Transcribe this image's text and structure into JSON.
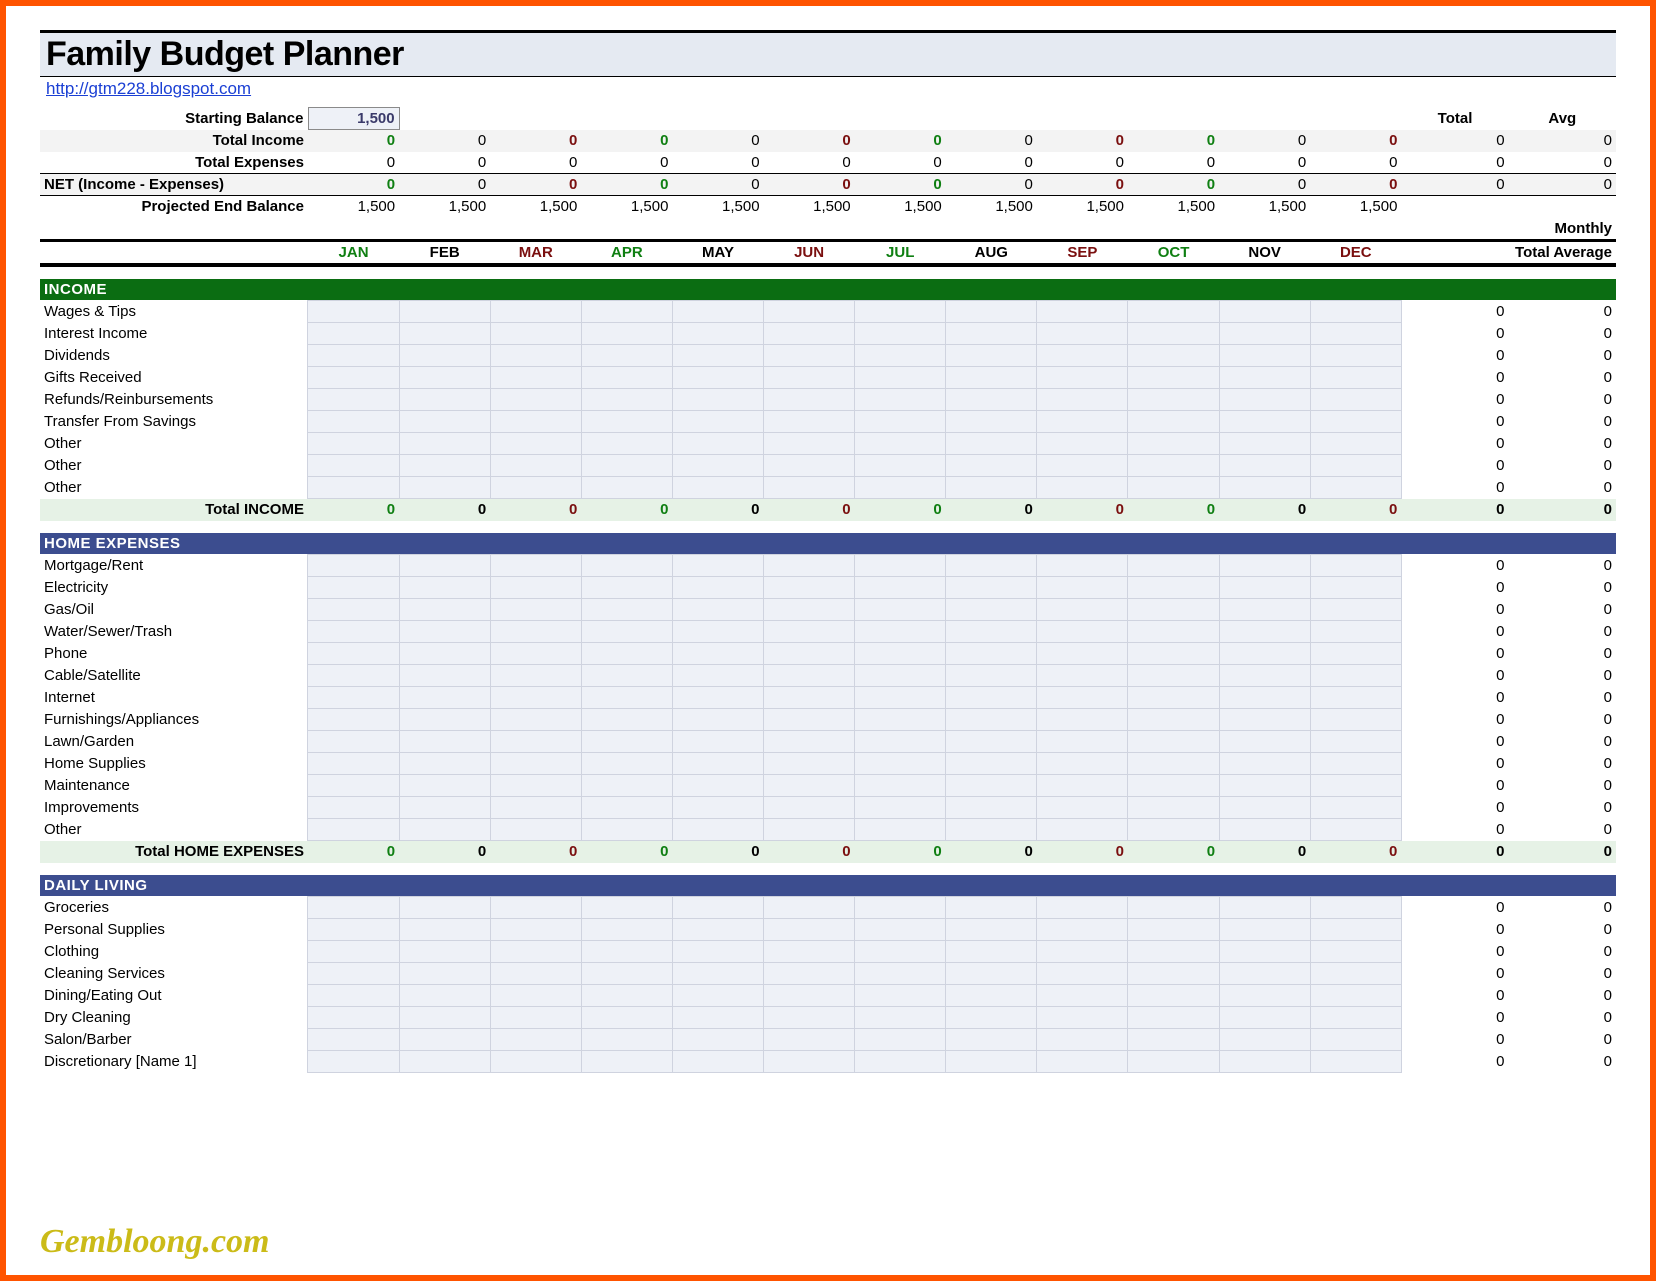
{
  "title": "Family Budget Planner",
  "sourceUrl": "http://gtm228.blogspot.com",
  "watermark": "Gembloong.com",
  "summary": {
    "startingBalanceLabel": "Starting Balance",
    "startingBalance": "1,500",
    "totalHeader": "Total",
    "avgHeader": "Avg",
    "monthlyLabel": "Monthly",
    "totalAverageLabel": "Total Average",
    "totalIncome": {
      "label": "Total Income",
      "months": [
        "0",
        "0",
        "0",
        "0",
        "0",
        "0",
        "0",
        "0",
        "0",
        "0",
        "0",
        "0"
      ],
      "total": "0",
      "avg": "0"
    },
    "totalExpenses": {
      "label": "Total Expenses",
      "months": [
        "0",
        "0",
        "0",
        "0",
        "0",
        "0",
        "0",
        "0",
        "0",
        "0",
        "0",
        "0"
      ],
      "total": "0",
      "avg": "0"
    },
    "net": {
      "label": "NET (Income - Expenses)",
      "months": [
        "0",
        "0",
        "0",
        "0",
        "0",
        "0",
        "0",
        "0",
        "0",
        "0",
        "0",
        "0"
      ],
      "total": "0",
      "avg": "0"
    },
    "projected": {
      "label": "Projected End Balance",
      "months": [
        "1,500",
        "1,500",
        "1,500",
        "1,500",
        "1,500",
        "1,500",
        "1,500",
        "1,500",
        "1,500",
        "1,500",
        "1,500",
        "1,500"
      ]
    }
  },
  "months": [
    "JAN",
    "FEB",
    "MAR",
    "APR",
    "MAY",
    "JUN",
    "JUL",
    "AUG",
    "SEP",
    "OCT",
    "NOV",
    "DEC"
  ],
  "monthColors": [
    "green",
    "plain",
    "darkred",
    "green",
    "plain",
    "darkred",
    "green",
    "plain",
    "darkred",
    "green",
    "plain",
    "darkred"
  ],
  "sections": [
    {
      "id": "income",
      "title": "INCOME",
      "headerClass": "sec-green",
      "totalLabel": "Total INCOME",
      "rows": [
        {
          "label": "Wages & Tips",
          "total": "0",
          "avg": "0"
        },
        {
          "label": "Interest Income",
          "total": "0",
          "avg": "0"
        },
        {
          "label": "Dividends",
          "total": "0",
          "avg": "0"
        },
        {
          "label": "Gifts Received",
          "total": "0",
          "avg": "0"
        },
        {
          "label": "Refunds/Reinbursements",
          "total": "0",
          "avg": "0"
        },
        {
          "label": "Transfer From Savings",
          "total": "0",
          "avg": "0"
        },
        {
          "label": "Other",
          "total": "0",
          "avg": "0"
        },
        {
          "label": "Other",
          "total": "0",
          "avg": "0"
        },
        {
          "label": "Other",
          "total": "0",
          "avg": "0"
        }
      ],
      "totals": {
        "months": [
          "0",
          "0",
          "0",
          "0",
          "0",
          "0",
          "0",
          "0",
          "0",
          "0",
          "0",
          "0"
        ],
        "total": "0",
        "avg": "0"
      }
    },
    {
      "id": "home",
      "title": "HOME EXPENSES",
      "headerClass": "sec-blue",
      "totalLabel": "Total HOME EXPENSES",
      "rows": [
        {
          "label": "Mortgage/Rent",
          "total": "0",
          "avg": "0"
        },
        {
          "label": "Electricity",
          "total": "0",
          "avg": "0"
        },
        {
          "label": "Gas/Oil",
          "total": "0",
          "avg": "0"
        },
        {
          "label": "Water/Sewer/Trash",
          "total": "0",
          "avg": "0"
        },
        {
          "label": "Phone",
          "total": "0",
          "avg": "0"
        },
        {
          "label": "Cable/Satellite",
          "total": "0",
          "avg": "0"
        },
        {
          "label": "Internet",
          "total": "0",
          "avg": "0"
        },
        {
          "label": "Furnishings/Appliances",
          "total": "0",
          "avg": "0"
        },
        {
          "label": "Lawn/Garden",
          "total": "0",
          "avg": "0"
        },
        {
          "label": "Home Supplies",
          "total": "0",
          "avg": "0"
        },
        {
          "label": "Maintenance",
          "total": "0",
          "avg": "0"
        },
        {
          "label": "Improvements",
          "total": "0",
          "avg": "0"
        },
        {
          "label": "Other",
          "total": "0",
          "avg": "0"
        }
      ],
      "totals": {
        "months": [
          "0",
          "0",
          "0",
          "0",
          "0",
          "0",
          "0",
          "0",
          "0",
          "0",
          "0",
          "0"
        ],
        "total": "0",
        "avg": "0"
      }
    },
    {
      "id": "daily",
      "title": "DAILY LIVING",
      "headerClass": "sec-blue",
      "totalLabel": "",
      "rows": [
        {
          "label": "Groceries",
          "total": "0",
          "avg": "0"
        },
        {
          "label": "Personal Supplies",
          "total": "0",
          "avg": "0"
        },
        {
          "label": "Clothing",
          "total": "0",
          "avg": "0"
        },
        {
          "label": "Cleaning Services",
          "total": "0",
          "avg": "0"
        },
        {
          "label": "Dining/Eating Out",
          "total": "0",
          "avg": "0"
        },
        {
          "label": "Dry Cleaning",
          "total": "0",
          "avg": "0"
        },
        {
          "label": "Salon/Barber",
          "total": "0",
          "avg": "0"
        },
        {
          "label": "Discretionary [Name 1]",
          "total": "0",
          "avg": "0"
        }
      ]
    }
  ]
}
